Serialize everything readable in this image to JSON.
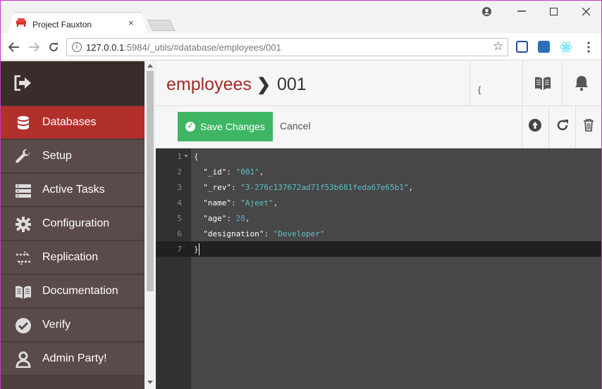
{
  "browser": {
    "tab_title": "Project Fauxton",
    "tab_close": "×",
    "url_host": "127.0.0.1",
    "url_rest": ":5984/_utils/#database/employees/001",
    "back_icon": "arrow-left-icon",
    "forward_icon": "arrow-right-icon",
    "reload_icon": "reload-icon"
  },
  "sidebar": {
    "items": [
      {
        "label": "Databases",
        "icon": "database-icon",
        "active": true
      },
      {
        "label": "Setup",
        "icon": "wrench-icon"
      },
      {
        "label": "Active Tasks",
        "icon": "tasks-icon"
      },
      {
        "label": "Configuration",
        "icon": "gear-icon"
      },
      {
        "label": "Replication",
        "icon": "replication-icon"
      },
      {
        "label": "Documentation",
        "icon": "book-icon"
      },
      {
        "label": "Verify",
        "icon": "check-circle-icon"
      },
      {
        "label": "Admin Party!",
        "icon": "user-icon"
      }
    ]
  },
  "header": {
    "database": "employees",
    "separator": "❯",
    "doc_id": "001",
    "json_label": "{\n} JSON"
  },
  "actions": {
    "save_label": "Save Changes",
    "cancel_label": "Cancel"
  },
  "editor": {
    "line_numbers": [
      "1",
      "2",
      "3",
      "4",
      "5",
      "6",
      "7"
    ],
    "lines": {
      "l1": "{",
      "id_key": "\"_id\"",
      "id_val": "\"001\"",
      "rev_key": "\"_rev\"",
      "rev_val": "\"3-276c137672ad71f53b681feda67e65b1\"",
      "name_key": "\"name\"",
      "name_val": "\"Ajeet\"",
      "age_key": "\"age\"",
      "age_val": "28",
      "desig_key": "\"designation\"",
      "desig_val": "\"Developer\"",
      "l7": "}"
    }
  },
  "colors": {
    "accent": "#b2302b",
    "save_green": "#3eb663",
    "sidebar_bg": "#4f3f3e"
  }
}
